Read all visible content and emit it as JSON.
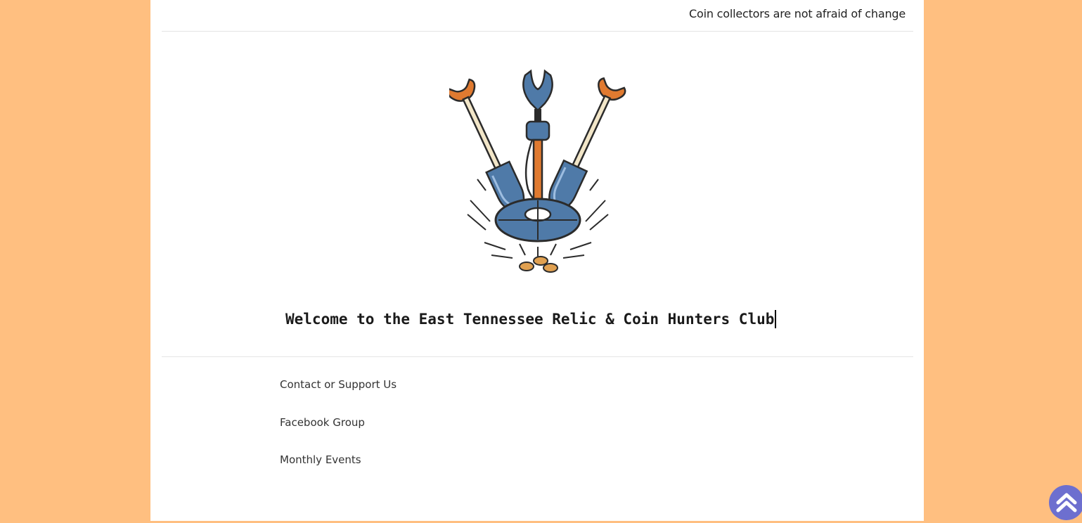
{
  "header": {
    "tagline": "Coin collectors are not afraid of change"
  },
  "hero": {
    "logo_icon": "metal-detector-shovels-logo",
    "heading": "Welcome to the East Tennessee Relic & Coin Hunters Club"
  },
  "nav": {
    "links": [
      {
        "label": "Contact or Support Us"
      },
      {
        "label": "Facebook Group"
      },
      {
        "label": "Monthly Events"
      }
    ]
  },
  "colors": {
    "background": "#ffbf80",
    "scroll_button": "#6d6fcf"
  },
  "scroll_top": {
    "icon": "double-chevron-up-icon"
  }
}
